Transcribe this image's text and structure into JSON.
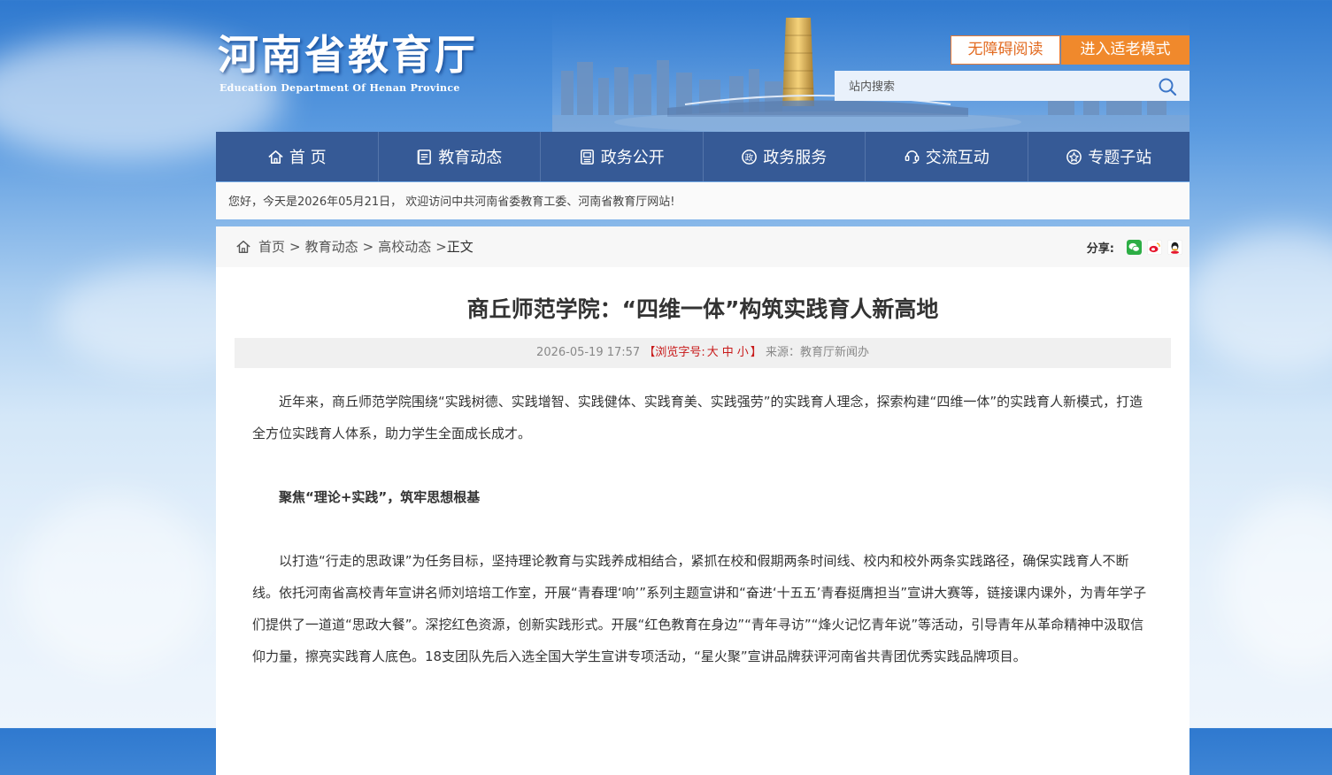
{
  "site": {
    "title_cn": "河南省教育厅",
    "title_en": "Education Department Of Henan Province"
  },
  "header": {
    "accessibility_label": "无障碍阅读",
    "elder_mode_label": "进入适老模式",
    "search_placeholder": "站内搜索"
  },
  "nav": {
    "items": [
      {
        "label": "首 页",
        "icon": "home-icon"
      },
      {
        "label": "教育动态",
        "icon": "news-icon"
      },
      {
        "label": "政务公开",
        "icon": "document-icon"
      },
      {
        "label": "政务服务",
        "icon": "service-icon"
      },
      {
        "label": "交流互动",
        "icon": "interaction-icon"
      },
      {
        "label": "专题子站",
        "icon": "topic-icon"
      }
    ]
  },
  "welcome_text": "您好，今天是2026年05月21日， 欢迎访问中共河南省委教育工委、河南省教育厅网站!",
  "breadcrumb": {
    "home": "首页",
    "level1": "教育动态",
    "level2": "高校动态",
    "current": "正文",
    "sep": ">"
  },
  "share": {
    "label": "分享:",
    "targets": [
      "wechat-icon",
      "weibo-icon",
      "qq-icon"
    ]
  },
  "article": {
    "title": "商丘师范学院：“四维一体”构筑实践育人新高地",
    "date": "2026-05-19 17:57",
    "font_size_prefix": "【浏览字号:",
    "font_large": "大",
    "font_medium": "中",
    "font_small": "小",
    "font_size_suffix": "】",
    "source": "来源：教育厅新闻办",
    "paragraphs": [
      "近年来，商丘师范学院围绕“实践树德、实践增智、实践健体、实践育美、实践强劳”的实践育人理念，探索构建“四维一体”的实践育人新模式，打造全方位实践育人体系，助力学生全面成长成才。",
      "聚焦“理论+实践”，筑牢思想根基",
      "以打造“行走的思政课”为任务目标，坚持理论教育与实践养成相结合，紧抓在校和假期两条时间线、校内和校外两条实践路径，确保实践育人不断线。依托河南省高校青年宣讲名师刘培培工作室，开展“青春理‘响’”系列主题宣讲和“奋进‘十五五’青春挺膺担当”宣讲大赛等，链接课内课外，为青年学子们提供了一道道“思政大餐”。深挖红色资源，创新实践形式。开展“红色教育在身边”“青年寻访”“烽火记忆青年说”等活动，引导青年从革命精神中汲取信仰力量，擦亮实践育人底色。18支团队先后入选全国大学生宣讲专项活动，“星火聚”宣讲品牌获评河南省共青团优秀实践品牌项目。"
    ]
  },
  "colors": {
    "nav_bg": "#365a96",
    "accent_orange": "#f0892c",
    "highlight_red": "#c81a1a"
  }
}
